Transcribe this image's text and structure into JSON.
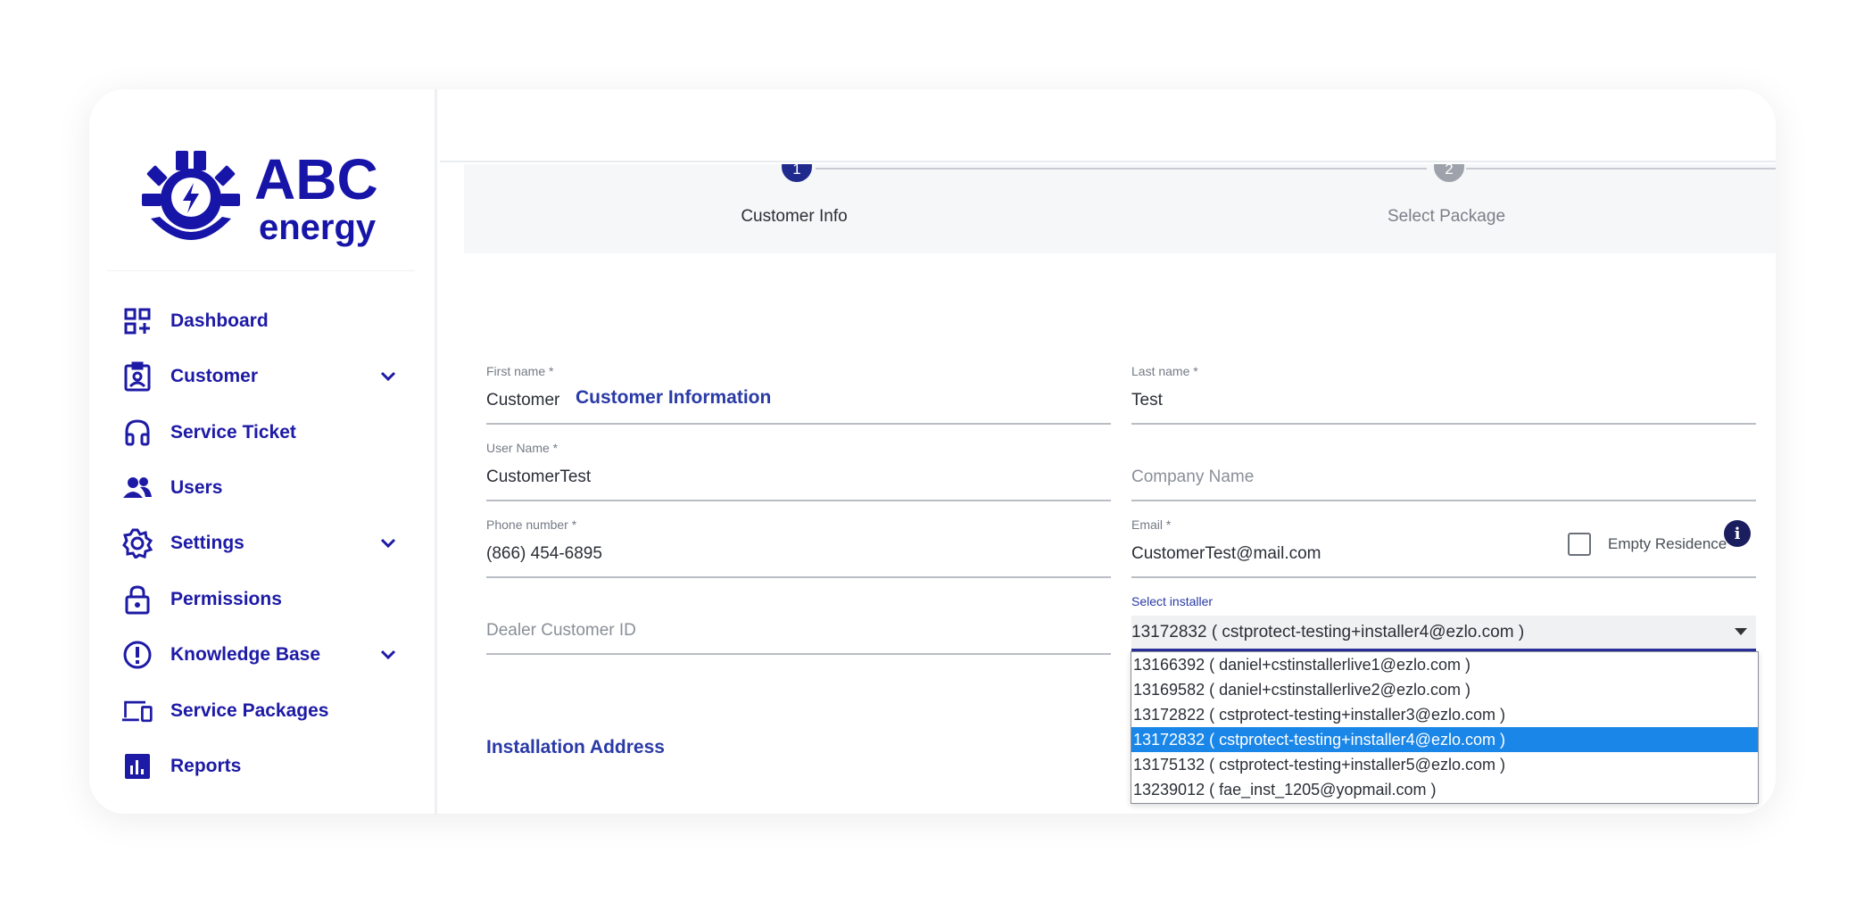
{
  "brand": {
    "line1": "ABC",
    "line2": "energy",
    "color": "#1714a8"
  },
  "nav": {
    "dashboard": "Dashboard",
    "customer": "Customer",
    "service_ticket": "Service Ticket",
    "users": "Users",
    "settings": "Settings",
    "permissions": "Permissions",
    "knowledge_base": "Knowledge Base",
    "service_packages": "Service Packages",
    "reports": "Reports"
  },
  "stepper": {
    "step1": {
      "number": "1",
      "label": "Customer Info",
      "active": true
    },
    "step2": {
      "number": "2",
      "label": "Select Package",
      "active": false
    }
  },
  "form": {
    "section_title": "Customer Information",
    "first_name": {
      "label": "First name *",
      "value": "Customer"
    },
    "last_name": {
      "label": "Last name *",
      "value": "Test"
    },
    "user_name": {
      "label": "User Name *",
      "value": "CustomerTest"
    },
    "company_name": {
      "placeholder": "Company Name"
    },
    "phone": {
      "label": "Phone number *",
      "value": "(866) 454-6895"
    },
    "email": {
      "label": "Email *",
      "value": "CustomerTest@mail.com"
    },
    "empty_residence": {
      "label": "Empty Residence",
      "checked": false
    },
    "dealer_customer_id": {
      "placeholder": "Dealer Customer ID"
    },
    "installer": {
      "label": "Select installer",
      "selected": "13172832 ( cstprotect-testing+installer4@ezlo.com )",
      "options": [
        "13166392 ( daniel+cstinstallerlive1@ezlo.com )",
        "13169582 ( daniel+cstinstallerlive2@ezlo.com )",
        "13172822 ( cstprotect-testing+installer3@ezlo.com )",
        "13172832 ( cstprotect-testing+installer4@ezlo.com )",
        "13175132 ( cstprotect-testing+installer5@ezlo.com )",
        "13239012 ( fae_inst_1205@yopmail.com )"
      ]
    },
    "installation_address_title": "Installation Address"
  },
  "colors": {
    "accent": "#1d1aa6",
    "step_active": "#1f2a8c",
    "step_inactive": "#9ea2aa",
    "selection": "#1a86e8"
  }
}
